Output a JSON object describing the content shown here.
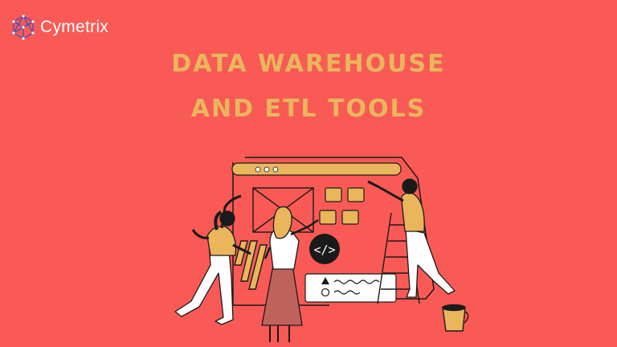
{
  "brand": {
    "name": "Cymetrix",
    "logo_icon": "cymetrix-hexagon-logo-icon"
  },
  "headline": {
    "line1": "DATA WAREHOUSE",
    "line2": "AND ETL TOOLS"
  },
  "colors": {
    "background": "#f95a55",
    "accent": "#e9b65c",
    "ink": "#1a1a1a",
    "white": "#ffffff"
  },
  "illustration": {
    "code_symbol": "</>"
  }
}
